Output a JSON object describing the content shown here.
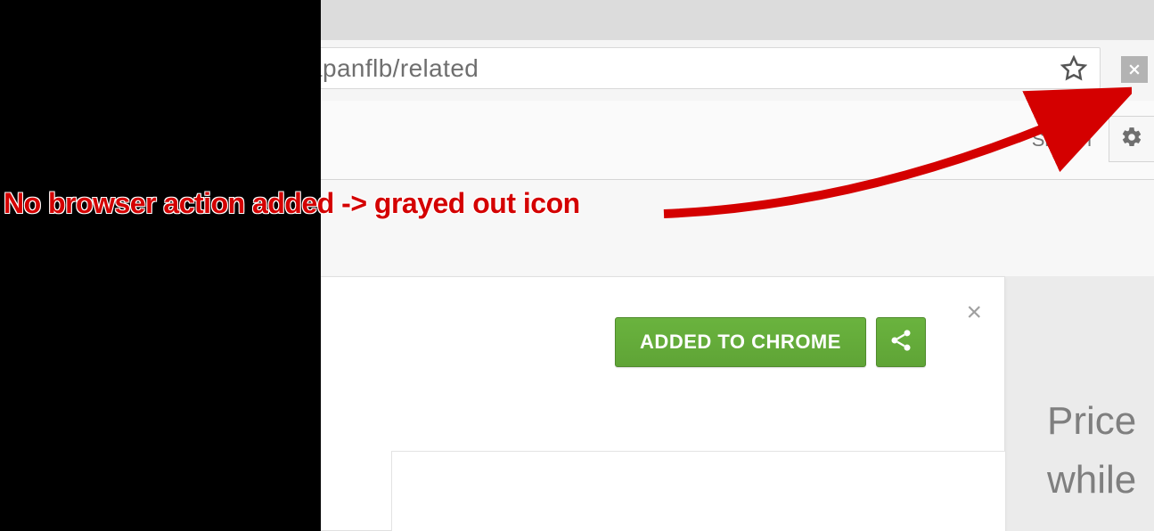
{
  "omnibox": {
    "url_fragment": "adieiomfhapanflb/related"
  },
  "infobar": {
    "sign_in_label": "Sign in"
  },
  "popup": {
    "added_button_label": "ADDED TO CHROME",
    "close_glyph": "×"
  },
  "sidebar_preview": {
    "line1": "Price",
    "line2": "while"
  },
  "annotation": {
    "text": "No browser action added -> grayed out icon"
  },
  "icons": {
    "star": "star-icon",
    "ext": "extension-icon",
    "gear": "gear-icon",
    "share": "share-icon",
    "close": "close-icon"
  }
}
